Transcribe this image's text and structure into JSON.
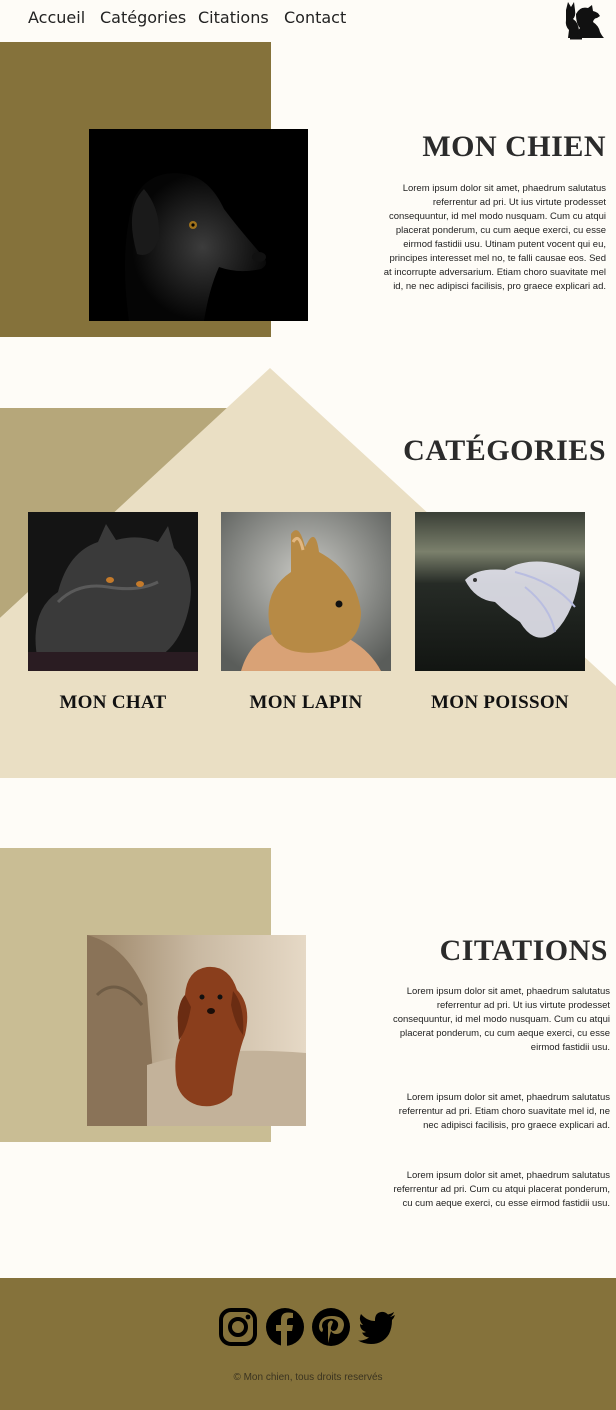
{
  "nav": {
    "items": [
      "Accueil",
      "Catégories",
      "Citations",
      "Contact"
    ]
  },
  "logo": {
    "icon": "pets-logo-icon"
  },
  "dog_section": {
    "title": "MON CHIEN",
    "paragraph": "Lorem ipsum dolor sit amet, phaedrum salutatus referrentur ad pri. Ut ius virtute prodesset consequuntur, id mel modo nusquam. Cum cu atqui placerat ponderum, cu cum aeque exerci, cu esse eirmod fastidii usu. Utinam putent vocent qui eu, principes interesset mel no, te falli causae eos. Sed at incorrupte adversarium. Etiam choro suavitate mel id, ne nec adipisci facilisis, pro graece explicari ad."
  },
  "categories": {
    "title": "CATÉGORIES",
    "items": [
      {
        "label": "MON CHAT"
      },
      {
        "label": "MON LAPIN"
      },
      {
        "label": "MON POISSON"
      }
    ]
  },
  "quotes": {
    "title": "CITATIONS",
    "paragraphs": [
      "Lorem ipsum dolor sit amet, phaedrum salutatus referrentur ad pri. Ut ius virtute prodesset consequuntur, id mel modo nusquam. Cum cu atqui placerat ponderum, cu cum aeque exerci, cu esse eirmod fastidii usu.",
      "Lorem ipsum dolor sit amet, phaedrum salutatus referrentur ad pri. Etiam choro suavitate mel id, ne nec adipisci facilisis, pro graece explicari ad.",
      "Lorem ipsum dolor sit amet, phaedrum salutatus referrentur ad pri. Cum cu atqui placerat ponderum, cu cum aeque exerci, cu esse eirmod fastidii usu."
    ]
  },
  "footer": {
    "social": [
      "instagram-icon",
      "facebook-icon",
      "pinterest-icon",
      "twitter-icon"
    ],
    "copyright": "© Mon chien, tous droits reservés"
  },
  "colors": {
    "olive": "#85723b",
    "beige": "#eadfc4",
    "tan": "#c9bd94",
    "background": "#fefcf7"
  }
}
